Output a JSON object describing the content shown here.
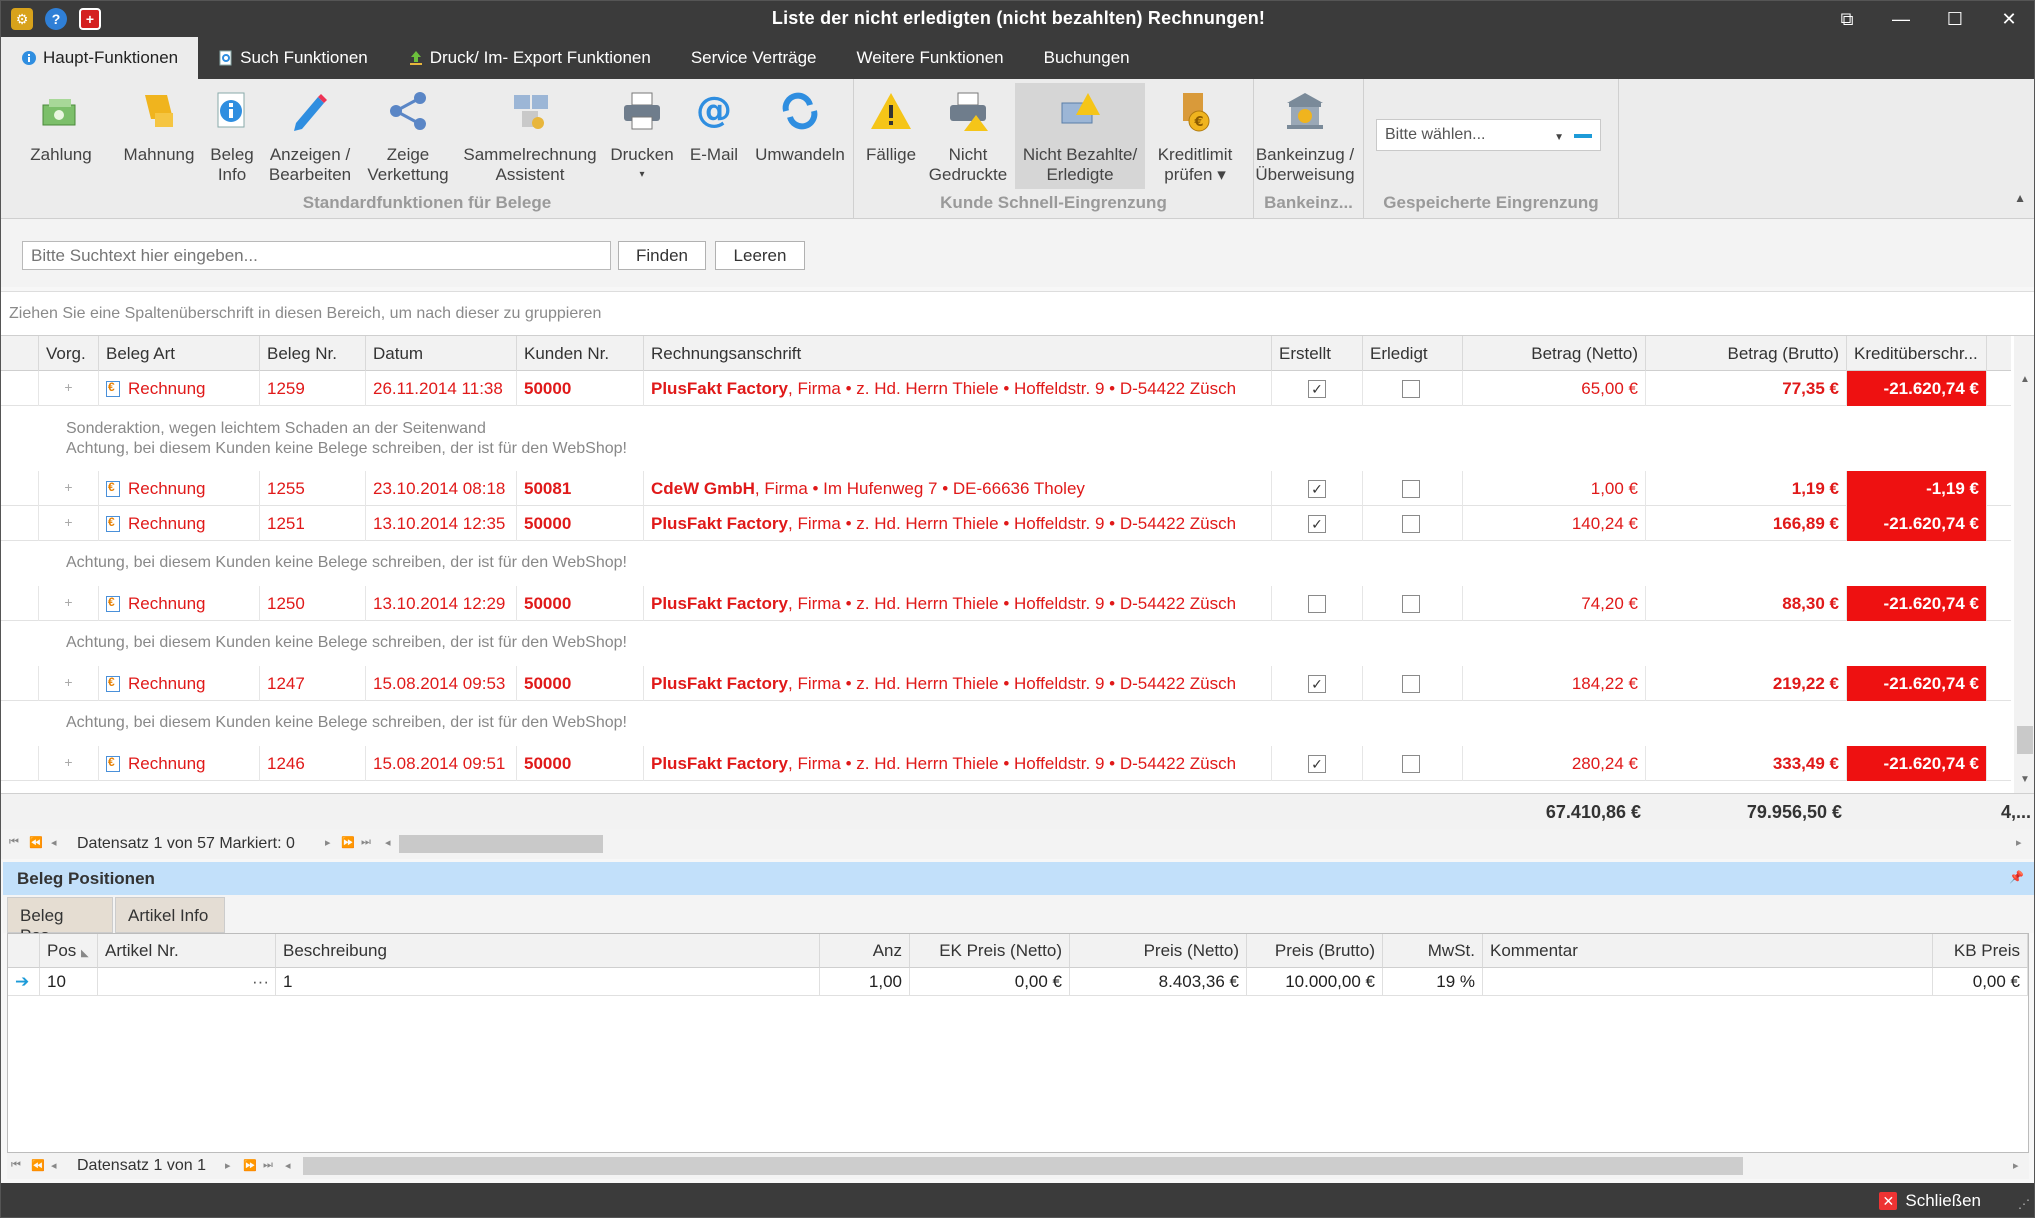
{
  "window": {
    "title": "Liste der nicht erledigten (nicht bezahlten) Rechnungen!",
    "buttons": [
      "⧉",
      "—",
      "☐",
      "✕"
    ]
  },
  "tabs": [
    "Haupt-Funktionen",
    "Such Funktionen",
    "Druck/ Im- Export Funktionen",
    "Service Verträge",
    "Weitere Funktionen",
    "Buchungen"
  ],
  "ribbon": {
    "groups": [
      "Standardfunktionen für Belege",
      "Kunde Schnell-Eingrenzung",
      "Bankeinz...",
      "Gespeicherte Eingrenzung"
    ],
    "buttons": [
      {
        "l1": "Zahlung",
        "l2": "",
        "icon": "cash-icon"
      },
      {
        "l1": "Mahnung",
        "l2": "",
        "icon": "reminder-icon"
      },
      {
        "l1": "Beleg",
        "l2": "Info",
        "icon": "info-icon"
      },
      {
        "l1": "Anzeigen /",
        "l2": "Bearbeiten",
        "icon": "pencil-icon"
      },
      {
        "l1": "Zeige",
        "l2": "Verkettung",
        "icon": "share-icon"
      },
      {
        "l1": "Sammelrechnung",
        "l2": "Assistent",
        "icon": "wizard-icon"
      },
      {
        "l1": "Drucken",
        "l2": "▾",
        "icon": "printer-icon"
      },
      {
        "l1": "E-Mail",
        "l2": "",
        "icon": "at-icon"
      },
      {
        "l1": "Umwandeln",
        "l2": "",
        "icon": "convert-icon"
      },
      {
        "l1": "Fällige",
        "l2": "",
        "icon": "warning-icon"
      },
      {
        "l1": "Nicht",
        "l2": "Gedruckte",
        "icon": "printer-warning-icon"
      },
      {
        "l1": "Nicht Bezahlte/",
        "l2": "Erledigte",
        "icon": "unpaid-icon"
      },
      {
        "l1": "Kreditlimit",
        "l2": "prüfen ▾",
        "icon": "coins-icon"
      },
      {
        "l1": "Bankeinzug /",
        "l2": "Überweisung",
        "icon": "bank-icon"
      }
    ],
    "combo_placeholder": "Bitte wählen..."
  },
  "search": {
    "placeholder": "Bitte Suchtext hier eingeben...",
    "find": "Finden",
    "clear": "Leeren"
  },
  "group_hint": "Ziehen Sie eine Spaltenüberschrift in diesen Bereich, um nach dieser zu gruppieren",
  "columns": [
    "Vorg.",
    "Beleg Art",
    "Beleg Nr.",
    "Datum",
    "Kunden Nr.",
    "Rechnungsanschrift",
    "Erstellt",
    "Erledigt",
    "Betrag (Netto)",
    "Betrag (Brutto)",
    "Kreditüberschr..."
  ],
  "rows": [
    {
      "art": "Rechnung",
      "nr": "1259",
      "datum": "26.11.2014 11:38",
      "kunde": "50000",
      "firma": "PlusFakt Factory",
      "adresse": ", Firma • z. Hd. Herrn Thiele • Hoffeldstr. 9 • D-54422 Züsch",
      "erstellt": "✓",
      "netto": "65,00 €",
      "brutto": "77,35 €",
      "kredit": "-21.620,74 €"
    },
    {
      "art": "Rechnung",
      "nr": "1255",
      "datum": "23.10.2014 08:18",
      "kunde": "50081",
      "firma": "CdeW GmbH",
      "adresse": ", Firma • Im Hufenweg 7 • DE-66636 Tholey",
      "erstellt": "✓",
      "netto": "1,00 €",
      "brutto": "1,19 €",
      "kredit": "-1,19 €"
    },
    {
      "art": "Rechnung",
      "nr": "1251",
      "datum": "13.10.2014 12:35",
      "kunde": "50000",
      "firma": "PlusFakt Factory",
      "adresse": ", Firma • z. Hd. Herrn Thiele • Hoffeldstr. 9 • D-54422 Züsch",
      "erstellt": "✓",
      "netto": "140,24 €",
      "brutto": "166,89 €",
      "kredit": "-21.620,74 €"
    },
    {
      "art": "Rechnung",
      "nr": "1250",
      "datum": "13.10.2014 12:29",
      "kunde": "50000",
      "firma": "PlusFakt Factory",
      "adresse": ", Firma • z. Hd. Herrn Thiele • Hoffeldstr. 9 • D-54422 Züsch",
      "erstellt": "",
      "netto": "74,20 €",
      "brutto": "88,30 €",
      "kredit": "-21.620,74 €"
    },
    {
      "art": "Rechnung",
      "nr": "1247",
      "datum": "15.08.2014 09:53",
      "kunde": "50000",
      "firma": "PlusFakt Factory",
      "adresse": ", Firma • z. Hd. Herrn Thiele • Hoffeldstr. 9 • D-54422 Züsch",
      "erstellt": "✓",
      "netto": "184,22 €",
      "brutto": "219,22 €",
      "kredit": "-21.620,74 €"
    },
    {
      "art": "Rechnung",
      "nr": "1246",
      "datum": "15.08.2014 09:51",
      "kunde": "50000",
      "firma": "PlusFakt Factory",
      "adresse": ", Firma • z. Hd. Herrn Thiele • Hoffeldstr. 9 • D-54422 Züsch",
      "erstellt": "✓",
      "netto": "280,24 €",
      "brutto": "333,49 €",
      "kredit": "-21.620,74 €"
    }
  ],
  "notes": {
    "r0a": "Sonderaktion, wegen leichtem Schaden an der Seitenwand",
    "r0b": "Achtung, bei diesem Kunden keine Belege schreiben, der ist für den WebShop!",
    "r2": "Achtung, bei diesem Kunden keine Belege schreiben, der ist für den WebShop!",
    "r3": "Achtung, bei diesem Kunden keine Belege schreiben, der ist für den WebShop!",
    "r4": "Achtung, bei diesem Kunden keine Belege schreiben, der ist für den WebShop!"
  },
  "totals": {
    "netto": "67.410,86 €",
    "brutto": "79.956,50 €",
    "kredit": "4,..."
  },
  "nav": {
    "record": "Datensatz 1 von 57 Markiert: 0"
  },
  "panel": {
    "title": "Beleg Positionen",
    "tabs": [
      "Beleg Pos.",
      "Artikel Info"
    ],
    "columns": [
      "Pos",
      "Artikel Nr.",
      "Beschreibung",
      "Anz",
      "EK Preis (Netto)",
      "Preis (Netto)",
      "Preis (Brutto)",
      "MwSt.",
      "Kommentar",
      "KB Preis"
    ],
    "row": {
      "pos": "10",
      "artikel": "",
      "ellipsis": "···",
      "beschreibung": "1",
      "anz": "1,00",
      "ek": "0,00 €",
      "netto": "8.403,36 €",
      "brutto": "10.000,00 €",
      "mwst": "19 %",
      "kommentar": "",
      "kb": "0,00 €"
    },
    "record": "Datensatz 1 von 1"
  },
  "status": {
    "close": "Schließen"
  },
  "colors": {
    "accent": "#1d9bd8",
    "red": "#e01919",
    "neg_bg": "#ee1111",
    "panel_header": "#c2e0fa"
  }
}
